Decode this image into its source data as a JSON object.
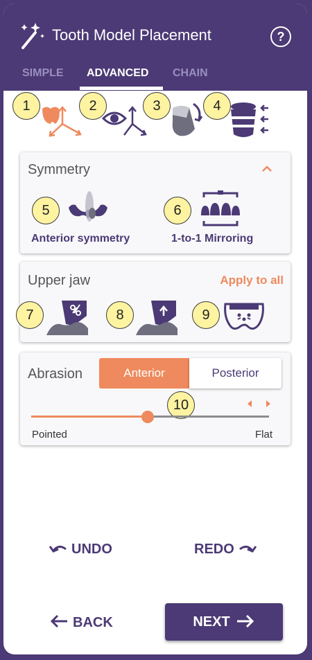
{
  "header": {
    "title": "Tooth Model Placement",
    "help_icon": "?"
  },
  "tabs": [
    {
      "label": "SIMPLE"
    },
    {
      "label": "ADVANCED",
      "active": true
    },
    {
      "label": "CHAIN"
    }
  ],
  "tool_icons": [
    {
      "number": "1",
      "icon": "move-tooth-icon"
    },
    {
      "number": "2",
      "icon": "view-axes-icon"
    },
    {
      "number": "3",
      "icon": "rotate-tooth-icon"
    },
    {
      "number": "4",
      "icon": "scale-tooth-icon"
    }
  ],
  "symmetry": {
    "title": "Symmetry",
    "items": [
      {
        "number": "5",
        "label": "Anterior symmetry"
      },
      {
        "number": "6",
        "label": "1-to-1 Mirroring"
      }
    ]
  },
  "upper_jaw": {
    "title": "Upper jaw",
    "apply_label": "Apply to all",
    "items": [
      {
        "number": "7"
      },
      {
        "number": "8"
      },
      {
        "number": "9"
      }
    ]
  },
  "abrasion": {
    "title": "Abrasion",
    "segments": [
      {
        "label": "Anterior",
        "active": true
      },
      {
        "label": "Posterior"
      }
    ],
    "number": "10",
    "slider": {
      "value": 0.49,
      "min_label": "Pointed",
      "max_label": "Flat"
    }
  },
  "actions": {
    "undo": "UNDO",
    "redo": "REDO",
    "back": "BACK",
    "next": "NEXT"
  },
  "colors": {
    "primary": "#4b3a75",
    "accent": "#ee8a5d",
    "badge": "#fdf3a1"
  }
}
